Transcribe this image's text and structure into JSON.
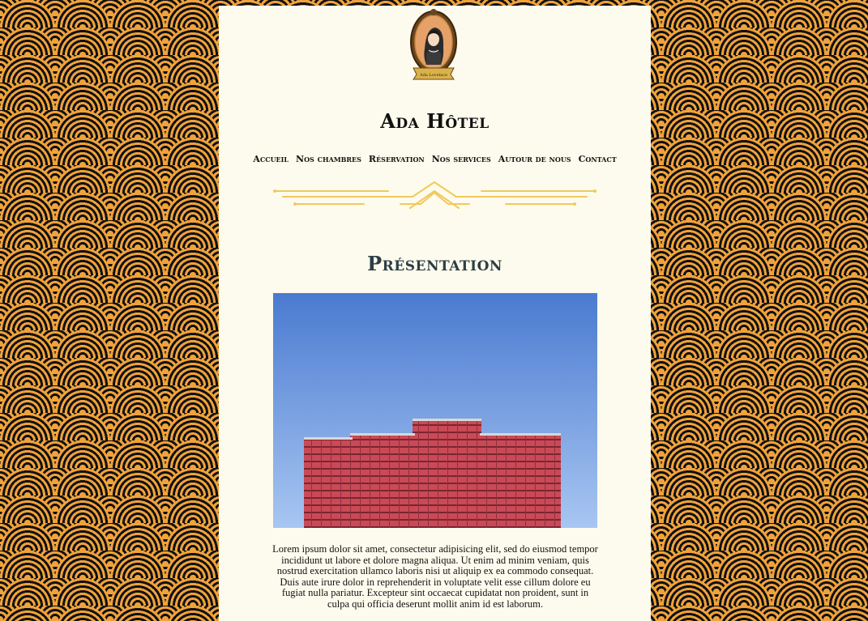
{
  "site": {
    "logo_caption": "Ada Lovelace",
    "title": "Ada Hôtel"
  },
  "nav": {
    "items": [
      "Accueil",
      "Nos chambres",
      "Réservation",
      "Nos services",
      "Autour de nous",
      "Contact"
    ]
  },
  "section": {
    "title": "Présentation"
  },
  "hero": {
    "icon": "hotel-building-photo",
    "sky_color": "#6e97dc",
    "building_color": "#c94a56"
  },
  "content": {
    "paragraph": "Lorem ipsum dolor sit amet, consectetur adipisicing elit, sed do eiusmod tempor incididunt ut labore et dolore magna aliqua. Ut enim ad minim veniam, quis nostrud exercitation ullamco laboris nisi ut aliquip ex ea commodo consequat. Duis aute irure dolor in reprehenderit in voluptate velit esse cillum dolore eu fugiat nulla pariatur. Excepteur sint occaecat cupidatat non proident, sunt in culpa qui officia deserunt mollit anim id est laborum."
  },
  "colors": {
    "accent": "#f0a23b",
    "panel": "#fdfbed",
    "divider": "#f2c85e"
  }
}
